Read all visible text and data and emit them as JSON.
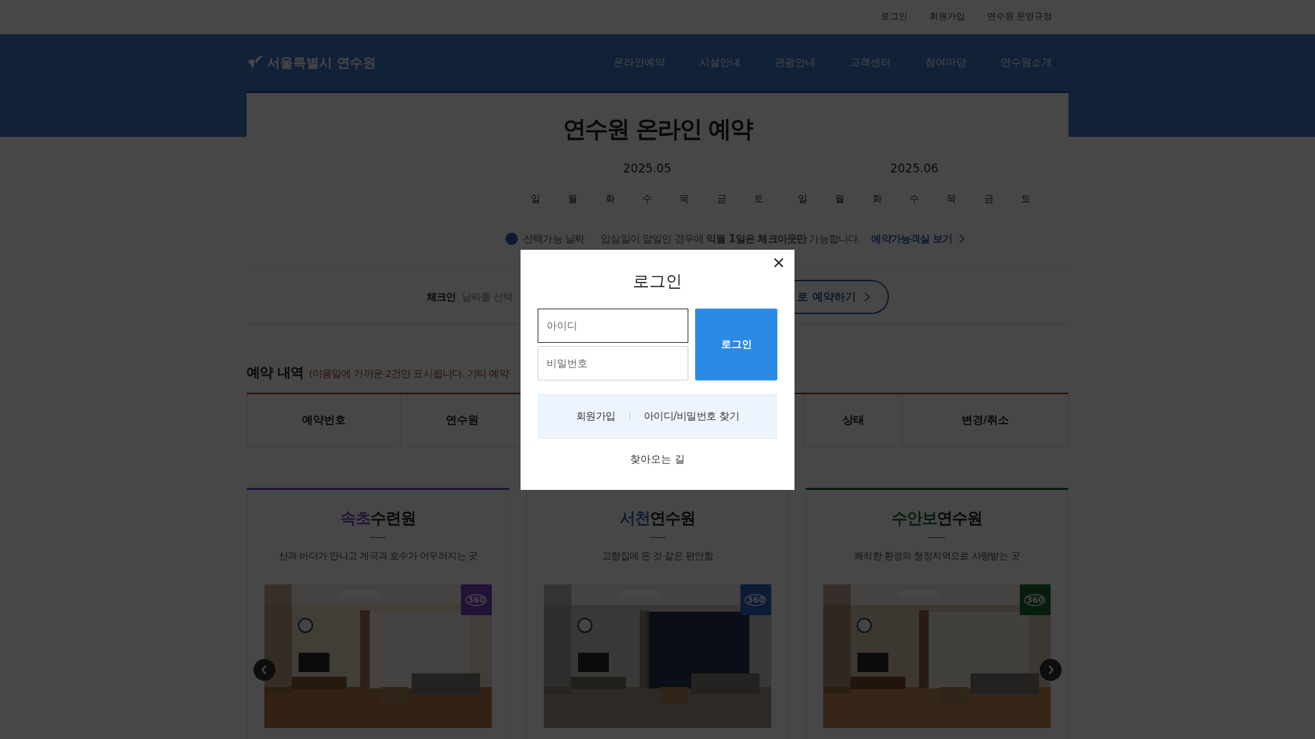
{
  "top_links": [
    "로그인",
    "회원가입",
    "연수원 운영규정"
  ],
  "logo": "서울특별시 연수원",
  "nav": [
    "온라인예약",
    "시설안내",
    "관광안내",
    "고객센터",
    "참여마당",
    "연수원소개"
  ],
  "page_title": "연수원 온라인 예약",
  "calendars": [
    {
      "month": "2025.05",
      "weekdays": [
        "일",
        "월",
        "화",
        "수",
        "목",
        "금",
        "토"
      ]
    },
    {
      "month": "2025.06",
      "weekdays": [
        "일",
        "월",
        "화",
        "수",
        "목",
        "금",
        "토"
      ]
    }
  ],
  "legend": {
    "label": "선택가능 날짜",
    "notice": "입실일이 말일인 경우에 **익월 1일은 체크아웃만** 가능합니다.",
    "link": "예약가능객실 보기"
  },
  "checkin": {
    "label": "체크인",
    "value": "날짜를 선택",
    "button": "로 예약하기"
  },
  "reservations": {
    "title": "예약 내역",
    "note": "(이용일에 가까운 2건만 표시됩니다. 기타 예약",
    "columns": [
      {
        "label": "예약번호"
      },
      {
        "label": "연수원"
      },
      {
        "label": "상태"
      },
      {
        "label": "변경/취소"
      }
    ]
  },
  "centers": [
    {
      "accent": "속초",
      "rest": "수련원",
      "color": "#221236",
      "desc": "산과 바다가 만나고 계곡과 호수가 어우러지는 곳",
      "badge": "360"
    },
    {
      "accent": "서천",
      "rest": "연수원",
      "color": "#0d1c36",
      "desc": "고향집에 온 것 같은 편안함",
      "badge": "360"
    },
    {
      "accent": "수안보",
      "rest": "연수원",
      "color": "#071d0e",
      "desc": "쾌적한 환경의 청정지역으로 사랑받는 곳",
      "badge": "360"
    }
  ],
  "modal": {
    "title": "로그인",
    "id_placeholder": "아이디",
    "pw_placeholder": "비밀번호",
    "login_button": "로그인",
    "links": [
      "회원가입",
      "아이디/비밀번호 찾기"
    ],
    "directions": "찾아오는 길"
  }
}
